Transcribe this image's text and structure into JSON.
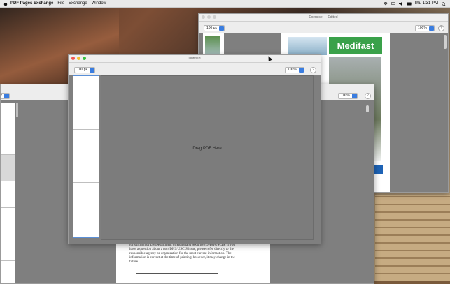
{
  "menubar": {
    "app_name": "PDF Pages Exchange",
    "items": [
      "File",
      "Exchange",
      "Window"
    ],
    "clock": "Thu 1:31 PM"
  },
  "back_window": {
    "title": "Exercise — Edited",
    "thumb_size": "100 px",
    "zoom": "100%",
    "ad_brand": "Medifast"
  },
  "middle_window": {
    "thumb_size": "100 px",
    "zoom": "100%"
  },
  "front_window": {
    "title": "Untitled",
    "thumb_size": "100 px",
    "zoom": "100%",
    "help": "?",
    "drop_label": "Drag PDF Here"
  },
  "document_text": {
    "paragraph": [
      "jurisdiction of US Department of Homeland Security (DHS)/USCIS. If you",
      "have a question about a non-DHS/USCIS issue, please refer directly to the",
      "responsible agency or organization for the most current information. The",
      "information is correct at the time of printing; however, it may change in the",
      "future."
    ]
  },
  "colors": {
    "accent": "#3a7de0",
    "medifast_green": "#3aa14a",
    "window_gray": "#7f7f7f"
  }
}
